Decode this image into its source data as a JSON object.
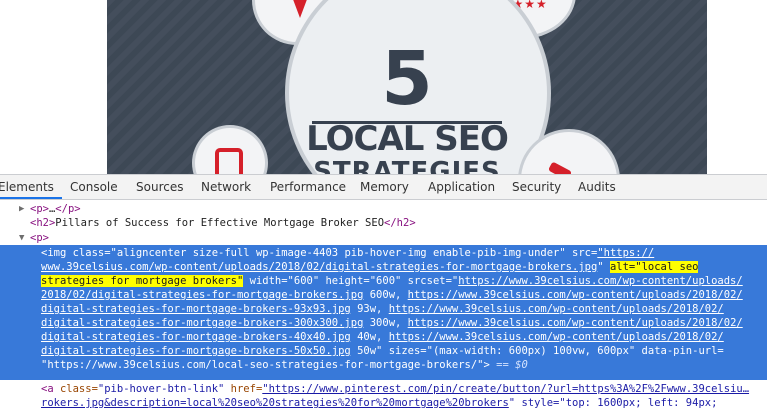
{
  "hero": {
    "number": "5",
    "title": "LOCAL SEO",
    "subtitle": "STRATEGIES",
    "stars": "★★★★★"
  },
  "devtools": {
    "tabs": [
      "Elements",
      "Console",
      "Sources",
      "Network",
      "Performance",
      "Memory",
      "Application",
      "Security",
      "Audits"
    ],
    "active_tab": "Elements",
    "line_p_collapsed": {
      "open": "<p>",
      "dots": "…",
      "close": "</p>"
    },
    "line_h2": {
      "open": "<h2>",
      "text": "Pillars of Success for Effective Mortgage Broker SEO",
      "close": "</h2>"
    },
    "line_p_open": "<p>",
    "img": {
      "l1_a": "<img ",
      "l1_attr_class": "class",
      "l1_val_class": "\"aligncenter size-full wp-image-4403 pib-hover-img enable-pib-img-under\"",
      "l1_attr_src": " src=",
      "l1_val_src_start": "\"https://",
      "l2_src": "www.39celsius.com/wp-content/uploads/2018/02/digital-strategies-for-mortgage-brokers.jpg",
      "l2_quote": "\"",
      "l2_alt_attr": "alt=",
      "l2_alt_val": "\"local seo",
      "l3_alt_val": "strategies for mortgage brokers\"",
      "l3_rest": " width=\"600\" height=\"600\" srcset=\"",
      "l3_link": "https://www.39celsius.com/wp-content/uploads/",
      "l4_a": "2018/02/digital-strategies-for-mortgage-brokers.jpg",
      "l4_b": " 600w, ",
      "l4_c": "https://www.39celsius.com/wp-content/uploads/2018/02/",
      "l5_a": "digital-strategies-for-mortgage-brokers-93x93.jpg",
      "l5_b": " 93w, ",
      "l5_c": "https://www.39celsius.com/wp-content/uploads/2018/02/",
      "l6_a": "digital-strategies-for-mortgage-brokers-300x300.jpg",
      "l6_b": " 300w, ",
      "l6_c": "https://www.39celsius.com/wp-content/uploads/2018/02/",
      "l7_a": "digital-strategies-for-mortgage-brokers-40x40.jpg",
      "l7_b": " 40w, ",
      "l7_c": "https://www.39celsius.com/wp-content/uploads/2018/02/",
      "l8_a": "digital-strategies-for-mortgage-brokers-50x50.jpg",
      "l8_b": " 50w\" sizes=\"(max-width: 600px) 100vw, 600px\" data-pin-url=",
      "l9_a": "\"https://www.39celsius.com/local-seo-strategies-for-mortgage-brokers/\">",
      "l9_eq": " == $0"
    },
    "anchor": {
      "l1_open": "<a ",
      "l1_class_attr": "class=",
      "l1_class_val": "\"pib-hover-btn-link\"",
      "l1_href_attr": " href=",
      "l1_href_val": "\"https://www.pinterest.com/pin/create/button/?url=https%3A%2F%2Fwww.39celsiu…",
      "l2_a": "rokers.jpg&description=local%20seo%20strategies%20for%20mortgage%20brokers",
      "l2_b": "\" style=",
      "l2_c": "\"top: 1600px; left: 94px;"
    }
  }
}
